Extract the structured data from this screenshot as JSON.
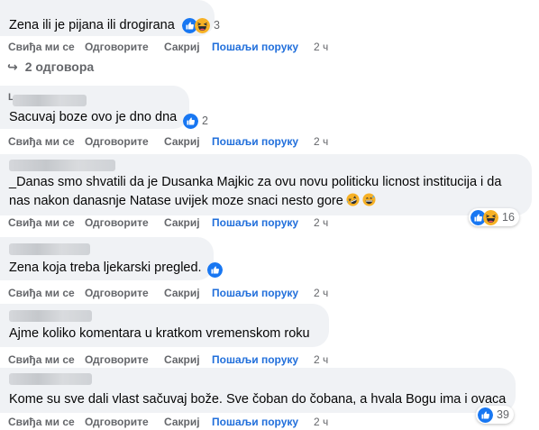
{
  "colors": {
    "bubble": "#f0f2f5",
    "action_text": "#65676b",
    "send_link": "#216fdb",
    "like_blue": "#1877f2",
    "haha_yellow": "#f7b125"
  },
  "actions": {
    "like": "Свиђа ми се",
    "reply": "Одговорите",
    "hide": "Сакриј",
    "send": "Пошаљи поруку"
  },
  "comments": [
    {
      "text": "Zena ili je pijana ili drogirana",
      "reactions": [
        "like-icon",
        "haha-icon"
      ],
      "reaction_count": "3",
      "time": "2 ч",
      "replies": "2 одговора"
    },
    {
      "name_initial": "L",
      "text": "Sacuvaj boze ovo je dno dna",
      "reactions": [
        "like-icon"
      ],
      "reaction_count": "2",
      "time": "2 ч"
    },
    {
      "text": "_Danas smo shvatili da je Dusanka Majkic za ovu novu politicku licnost institucija i da nas nakon danasnje Natase uvijek moze snaci nesto gore",
      "text_emojis": [
        "rofl-emoji",
        "grin-sweat-emoji"
      ],
      "reactions": [
        "like-icon",
        "haha-icon"
      ],
      "reaction_count": "16",
      "time": "2 ч"
    },
    {
      "text": "Zena koja treba ljekarski pregled.",
      "reactions": [
        "like-icon"
      ],
      "reaction_count": "",
      "time": "2 ч"
    },
    {
      "text": "Ajme koliko komentara u kratkom vremenskom roku",
      "reactions": [],
      "reaction_count": "",
      "time": "2 ч"
    },
    {
      "text": "Kome su sve dali vlast sačuvaj bože. Sve čoban do čobana, a hvala Bogu ima i ovaca",
      "reactions": [
        "like-icon"
      ],
      "reaction_count": "39",
      "time": "2 ч"
    }
  ]
}
